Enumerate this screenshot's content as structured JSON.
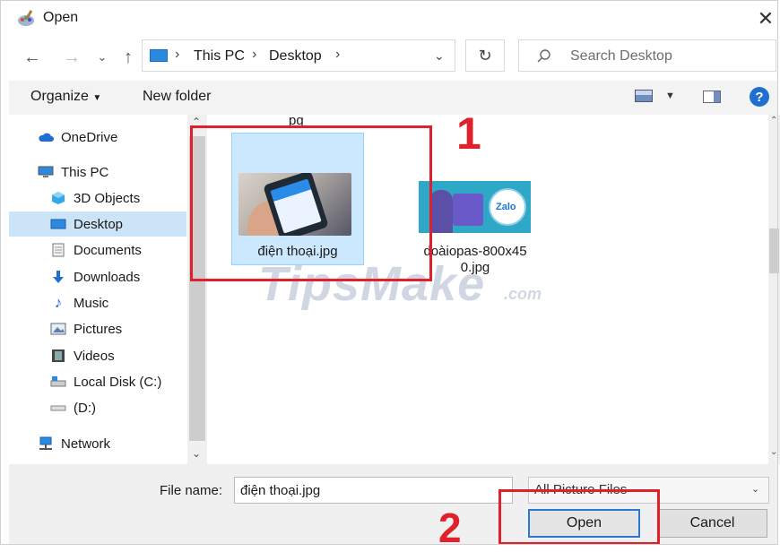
{
  "window": {
    "title": "Open"
  },
  "address_bar": {
    "breadcrumbs": [
      "This PC",
      "Desktop"
    ],
    "search_placeholder": "Search Desktop"
  },
  "toolbar": {
    "organize_label": "Organize",
    "new_folder_label": "New folder",
    "help_label": "?"
  },
  "nav_pane": {
    "items": [
      {
        "label": "OneDrive",
        "icon": "cloud-icon"
      },
      {
        "label": "This PC",
        "icon": "computer-icon"
      },
      {
        "label": "3D Objects",
        "icon": "cube-icon"
      },
      {
        "label": "Desktop",
        "icon": "desktop-icon",
        "selected": true
      },
      {
        "label": "Documents",
        "icon": "document-icon"
      },
      {
        "label": "Downloads",
        "icon": "download-arrow-icon"
      },
      {
        "label": "Music",
        "icon": "music-note-icon"
      },
      {
        "label": "Pictures",
        "icon": "pictures-icon"
      },
      {
        "label": "Videos",
        "icon": "film-icon"
      },
      {
        "label": "Local Disk (C:)",
        "icon": "drive-icon"
      },
      {
        "label": "(D:)",
        "icon": "drive-icon"
      },
      {
        "label": "Network",
        "icon": "network-icon"
      }
    ]
  },
  "files": {
    "partial_name": "pg",
    "items": [
      {
        "name": "điện thoại.jpg",
        "selected": true
      },
      {
        "name_line1": "doàiopas-800x45",
        "name_line2": "0.jpg"
      }
    ],
    "zalo_text": "Zalo"
  },
  "watermark": {
    "text": "TipsMake",
    "domain": ".com"
  },
  "annotations": {
    "step1": "1",
    "step2": "2"
  },
  "bottom": {
    "file_name_label": "File name:",
    "file_name_value": "điện thoại.jpg",
    "file_type_value": "All Picture Files",
    "open_label": "Open",
    "cancel_label": "Cancel"
  }
}
